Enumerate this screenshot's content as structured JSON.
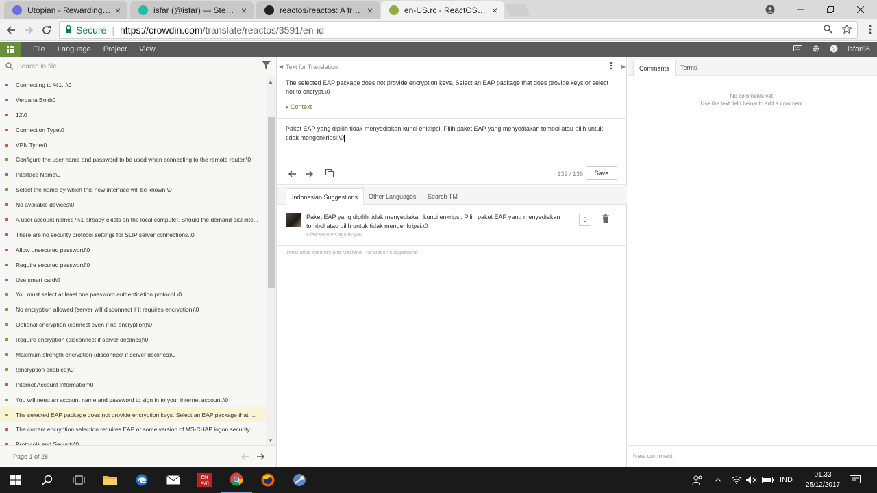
{
  "browser": {
    "tabs": [
      {
        "title": "Utopian - Rewarding Op",
        "icon_color": "#6a6ee0",
        "active": false
      },
      {
        "title": "isfar (@isfar) — Steemit",
        "icon_color": "#1fbfa8",
        "active": false
      },
      {
        "title": "reactos/reactos: A free W",
        "icon_color": "#222222",
        "active": false
      },
      {
        "title": "en-US.rc - ReactOS - Cro",
        "icon_color": "#8fae3f",
        "active": true
      }
    ],
    "close_glyph": "×",
    "secure_label": "Secure",
    "url_domain": "https://crowdin.com",
    "url_path": "/translate/reactos/3591/en-id"
  },
  "toolbar": {
    "menu": [
      "File",
      "Language",
      "Project",
      "View"
    ],
    "username": "isfar96"
  },
  "left": {
    "search_placeholder": "Search in file",
    "strings": [
      {
        "text": "Connecting to %1...\\0",
        "status": "red"
      },
      {
        "text": "Verdana Bold\\0",
        "status": "red"
      },
      {
        "text": "12\\0",
        "status": "red"
      },
      {
        "text": "Connection Type\\0",
        "status": "red"
      },
      {
        "text": "VPN Type\\0",
        "status": "red"
      },
      {
        "text": "Configure the user name and password to be used when connecting to the remote router.\\0",
        "status": "green"
      },
      {
        "text": "Interface Name\\0",
        "status": "red"
      },
      {
        "text": "Select the name by which this new interface will be known.\\0",
        "status": "green"
      },
      {
        "text": "No available devices\\0",
        "status": "red"
      },
      {
        "text": "A user account named %1 already exists on the local computer. Should the demand dial inte...",
        "status": "red"
      },
      {
        "text": "There are no security protocol settings for SLIP server connections.\\0",
        "status": "red"
      },
      {
        "text": "Allow unsecured password\\0",
        "status": "red"
      },
      {
        "text": "Require secured password\\0",
        "status": "red"
      },
      {
        "text": "Use smart card\\0",
        "status": "red"
      },
      {
        "text": "You must select at least one password authentication protocol.\\0",
        "status": "green"
      },
      {
        "text": "No encryption allowed (server will disconnect if it requires encryption)\\0",
        "status": "green"
      },
      {
        "text": "Optional encryption (connect even if no encryption)\\0",
        "status": "green"
      },
      {
        "text": "Require encryption (disconnect if server declines)\\0",
        "status": "green"
      },
      {
        "text": "Maximum strength encryption (disconnect if server declines)\\0",
        "status": "green"
      },
      {
        "text": "(encryption enabled)\\0",
        "status": "green"
      },
      {
        "text": "Internet Account Information\\0",
        "status": "red"
      },
      {
        "text": "You will need an account name and password to sign in to your Internet account.\\0",
        "status": "green"
      },
      {
        "text": "The selected EAP package does not provide encryption keys. Select an EAP package that doe...",
        "status": "green",
        "selected": true
      },
      {
        "text": "The current encryption selection requires EAP or some version of MS-CHAP logon security m...",
        "status": "red"
      },
      {
        "text": "Protocols and Security\\0",
        "status": "red"
      }
    ],
    "pager": "Page 1 of 28"
  },
  "mid": {
    "header": "Text for Translation",
    "source_text": "The selected EAP package does not provide encryption keys.  Select an EAP package that does provide keys or select not to encrypt.\\0",
    "context_label": "Context",
    "translation_text": "Paket EAP yang dipilih tidak menyediakan kunci enkripsi. Pilih paket EAP yang menyediakan tombol atau pilih untuk tidak mengenkripsi.\\0",
    "char_count": "132 / 135",
    "save_label": "Save",
    "sug_tabs": [
      "Indonesian Suggestions",
      "Other Languages",
      "Search TM"
    ],
    "suggestion": {
      "text": "Paket EAP yang dipilih tidak menyediakan kunci enkripsi. Pilih paket EAP yang menyediakan tombol atau pilih untuk tidak mengenkripsi.\\0",
      "meta": "a few seconds ago by you",
      "votes": "0"
    },
    "tm_note": "Translation Memory and Machine Translation suggestions"
  },
  "right": {
    "tabs": [
      "Comments",
      "Terms"
    ],
    "no_comments_line1": "No comments yet.",
    "no_comments_line2": "Use the text field below to add a comment.",
    "new_comment_placeholder": "New comment"
  },
  "taskbar": {
    "lang": "IND",
    "time": "01.33",
    "date": "25/12/2017"
  }
}
